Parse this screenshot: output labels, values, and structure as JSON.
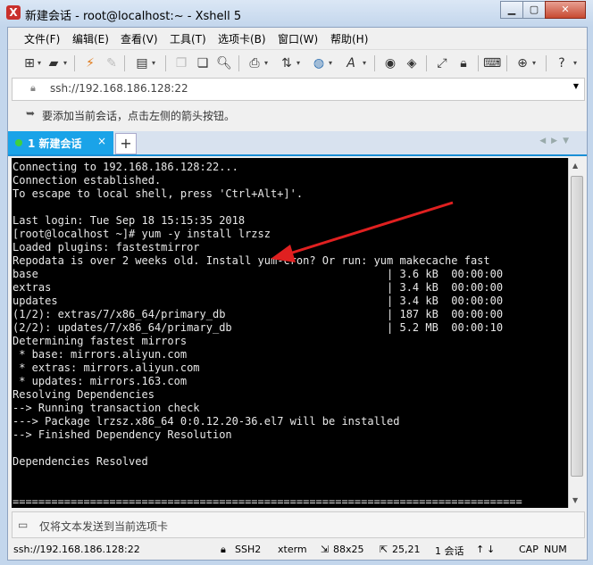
{
  "window": {
    "title": "新建会话 - root@localhost:~ - Xshell 5",
    "app_icon": "xshell-icon",
    "controls": [
      "minimize",
      "maximize",
      "close"
    ]
  },
  "menu": [
    "文件(F)",
    "编辑(E)",
    "查看(V)",
    "工具(T)",
    "选项卡(B)",
    "窗口(W)",
    "帮助(H)"
  ],
  "address": {
    "value": "ssh://192.168.186.128:22"
  },
  "hint": {
    "text": "要添加当前会话，点击左侧的箭头按钮。"
  },
  "tabs": [
    {
      "label": "1 新建会话",
      "close": "×"
    }
  ],
  "tab_add": "+",
  "terminal": {
    "lines": [
      "Connecting to 192.168.186.128:22...",
      "Connection established.",
      "To escape to local shell, press 'Ctrl+Alt+]'.",
      "",
      "Last login: Tue Sep 18 15:15:35 2018",
      "[root@localhost ~]# yum -y install lrzsz",
      "Loaded plugins: fastestmirror",
      "Repodata is over 2 weeks old. Install yum-cron? Or run: yum makecache fast",
      "base                                                      | 3.6 kB  00:00:00",
      "extras                                                    | 3.4 kB  00:00:00",
      "updates                                                   | 3.4 kB  00:00:00",
      "(1/2): extras/7/x86_64/primary_db                         | 187 kB  00:00:00",
      "(2/2): updates/7/x86_64/primary_db                        | 5.2 MB  00:00:10",
      "Determining fastest mirrors",
      " * base: mirrors.aliyun.com",
      " * extras: mirrors.aliyun.com",
      " * updates: mirrors.163.com",
      "Resolving Dependencies",
      "--> Running transaction check",
      "---> Package lrzsz.x86_64 0:0.12.20-36.el7 will be installed",
      "--> Finished Dependency Resolution",
      "",
      "Dependencies Resolved",
      "",
      "",
      "==============================================================================="
    ]
  },
  "input_bar": {
    "placeholder": "仅将文本发送到当前选项卡"
  },
  "status": {
    "connection": "ssh://192.168.186.128:22",
    "protocol": "SSH2",
    "terminal": "xterm",
    "size": "88x25",
    "cursor": "25,21",
    "sessions": "1 会话",
    "caps": "CAP",
    "num": "NUM"
  },
  "colors": {
    "tab_active": "#1aa3e8",
    "arrow": "#e02020",
    "terminal_bg": "#000000",
    "terminal_fg": "#e8e8e8"
  }
}
